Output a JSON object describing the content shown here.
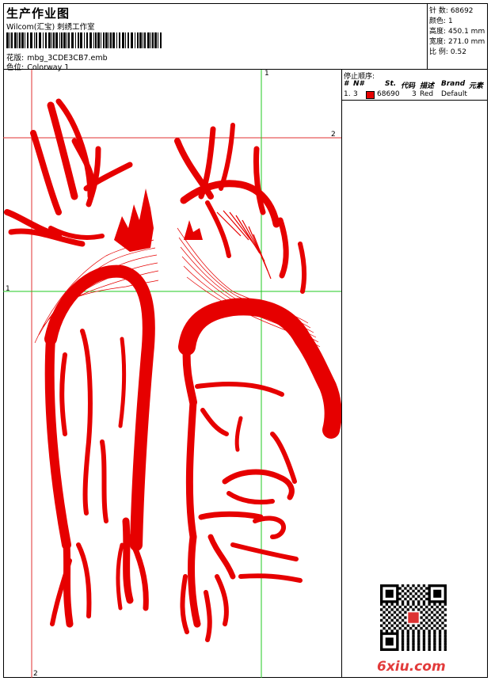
{
  "header": {
    "title": "生产作业图",
    "company": "Wilcom(汇宝) 刺绣工作室",
    "design_label": "花版:",
    "design_file": "mbg_3CDE3CB7.emb",
    "color_label": "色位:",
    "colorway": "Colorway 1"
  },
  "stats": [
    {
      "label": "针 数:",
      "value": "68692"
    },
    {
      "label": "颜色:",
      "value": "1"
    },
    {
      "label": "高度:",
      "value": "450.1 mm"
    },
    {
      "label": "宽度:",
      "value": "271.0 mm"
    },
    {
      "label": "比 例:",
      "value": "0.52"
    }
  ],
  "stop_sequence": {
    "title": "停止顺序:",
    "columns": [
      "#",
      "N#",
      "St.",
      "代码",
      "描述",
      "Brand",
      "元素"
    ],
    "rows": [
      {
        "index": "1.",
        "needle": "3",
        "stitches": "68690",
        "code": "3",
        "description": "Red",
        "brand": "Default",
        "swatch_color": "#e60000"
      }
    ]
  },
  "guides": {
    "top": "1",
    "right": "2",
    "left": "1",
    "bottom": "2"
  },
  "watermark": "6xiu.com",
  "colors": {
    "thread": "#e60000",
    "guide_red": "#e03030",
    "guide_green": "#22c822"
  }
}
